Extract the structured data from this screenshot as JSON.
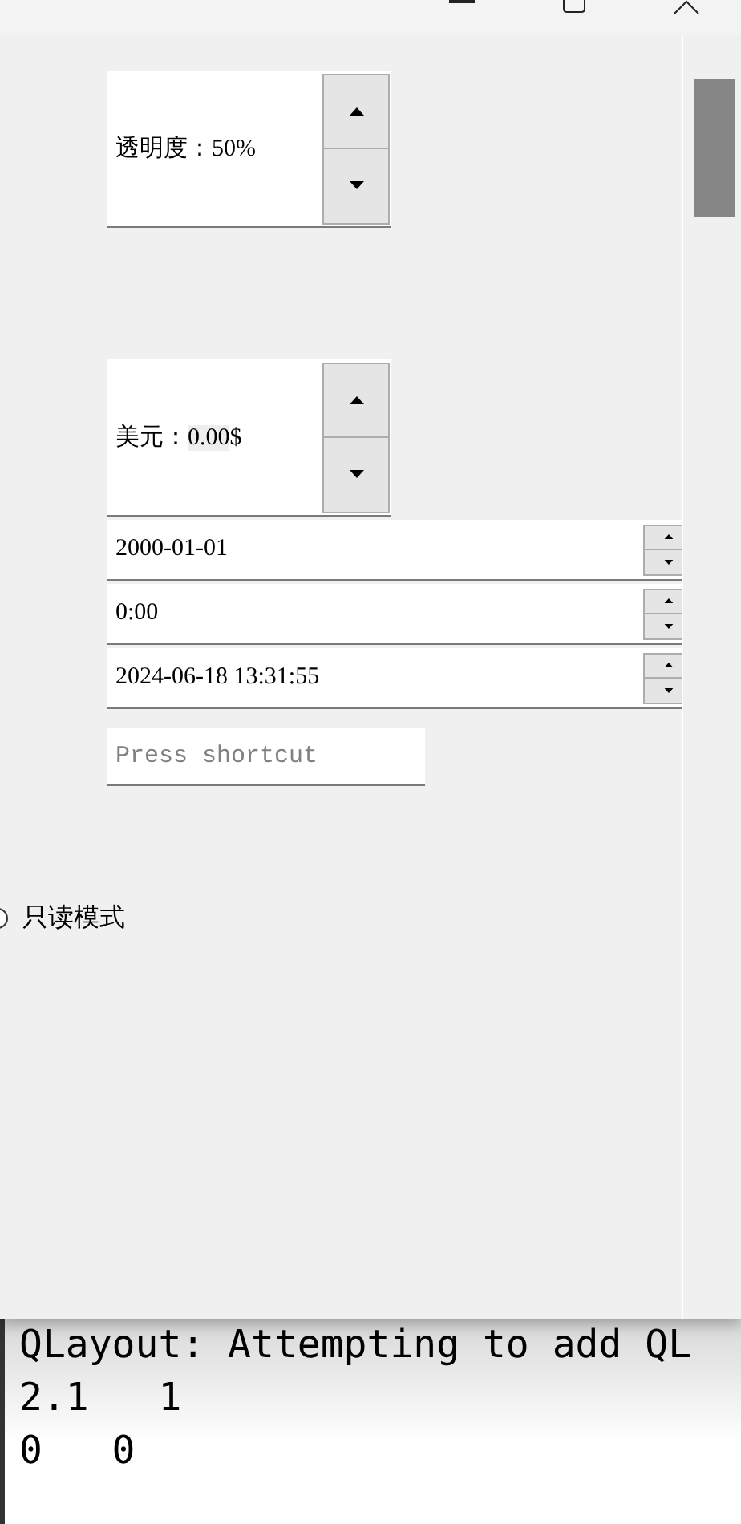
{
  "window": {
    "controls": [
      {
        "kind": "minimize"
      },
      {
        "kind": "maximize"
      },
      {
        "kind": "close"
      }
    ]
  },
  "spin_boxes": [
    {
      "prefix": "透明度：",
      "value": "50",
      "suffix": "%",
      "value_selected": false
    },
    {
      "prefix": "美元：",
      "value": "0.00",
      "suffix": "$",
      "value_selected": true
    }
  ],
  "date_time_edits": [
    {
      "value": "2000-01-01"
    },
    {
      "value": "0:00"
    },
    {
      "value": "2024-06-18 13:31:55"
    }
  ],
  "shortcut_field": {
    "placeholder": "Press shortcut"
  },
  "radio": {
    "label": "只读模式",
    "checked": false
  },
  "console": {
    "lines": [
      "QLayout: Attempting to add QL",
      "2.1   1",
      "0   0"
    ]
  }
}
